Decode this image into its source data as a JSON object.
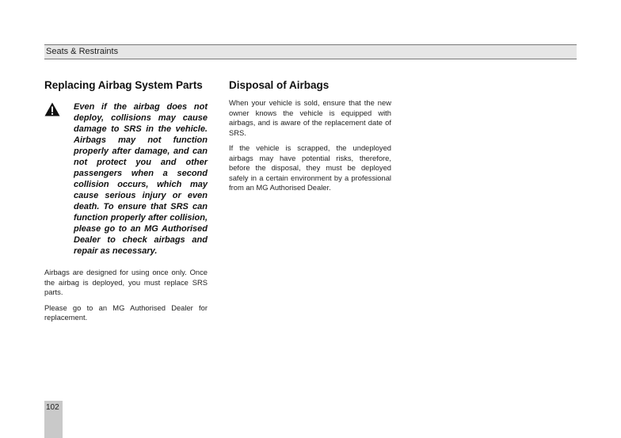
{
  "header": {
    "section_title": "Seats & Restraints"
  },
  "left_column": {
    "heading": "Replacing Airbag System Parts",
    "warning_icon": "warning-triangle-icon",
    "warning_text": "Even if the airbag does not deploy, collisions may cause damage to SRS in the vehicle. Airbags may not function properly after damage, and can not protect you and other passengers when a second collision occurs, which may cause serious injury or even death. To ensure that SRS can function properly after collision, please go to an MG Authorised Dealer to check airbags and repair as necessary.",
    "paragraphs": [
      "Airbags are designed for using once only. Once the airbag is deployed, you must replace SRS parts.",
      "Please go to an MG Authorised Dealer for replacement."
    ]
  },
  "right_column": {
    "heading": "Disposal of Airbags",
    "paragraphs": [
      "When your vehicle is sold, ensure that the new owner knows the vehicle is equipped with airbags, and is aware of the replacement date of SRS.",
      "If the vehicle is scrapped, the undeployed airbags may have potential risks, therefore, before the disposal, they must be deployed safely in a certain environment by a professional from an MG Authorised Dealer."
    ]
  },
  "footer": {
    "page_number": "102"
  }
}
